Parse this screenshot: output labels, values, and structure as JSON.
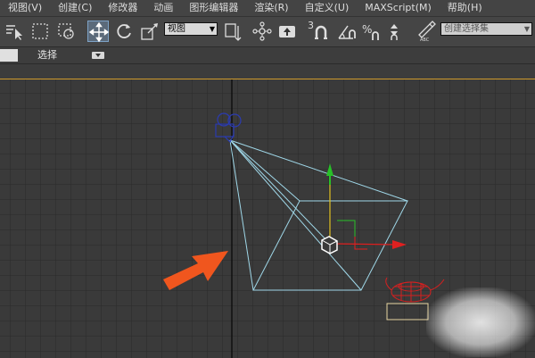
{
  "menubar": {
    "items": [
      "视图(V)",
      "创建(C)",
      "修改器",
      "动画",
      "图形编辑器",
      "渲染(R)",
      "自定义(U)",
      "MAXScript(M)",
      "帮助(H)"
    ]
  },
  "toolbar": {
    "viewport_dropdown": "视图",
    "snap_number": "3",
    "selection_set_dropdown": "创建选择集",
    "icons": [
      "select-object-icon",
      "rect-selection-icon",
      "window-crossing-icon",
      "move-icon",
      "rotate-icon",
      "scale-icon",
      "pivot-icon",
      "link-icon",
      "manipulate-icon",
      "snap-icon",
      "angle-snap-icon",
      "percent-snap-icon",
      "spinner-snap-icon",
      "edit-named-sets-icon"
    ]
  },
  "ribbon": {
    "tab_label": "选择"
  },
  "scene": {
    "objects": [
      "camera",
      "camera-target",
      "camera-frustum",
      "move-gizmo",
      "teapot"
    ],
    "annotation": "orange-arrow",
    "colors": {
      "grid": "#2a2a2a",
      "grid_major": "#101010",
      "frustum": "#9fd7e8",
      "camera": "#2b3bb0",
      "gizmo_y": "#28c028",
      "gizmo_x": "#e02020",
      "gizmo_z": "#e0c020",
      "teapot": "#d52020",
      "arrow": "#f0561e",
      "viewport_border": "#cf9a2c"
    }
  }
}
